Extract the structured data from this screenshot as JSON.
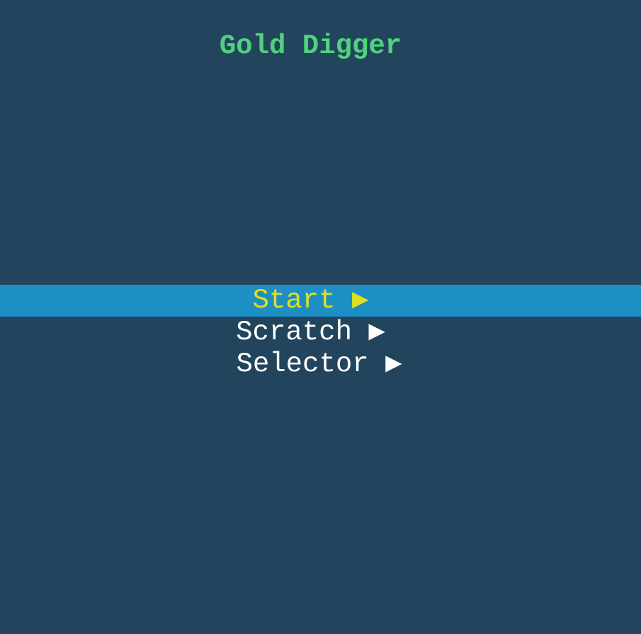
{
  "title": "Gold Digger",
  "menu": {
    "items": [
      {
        "label": "Start",
        "arrow": "▶",
        "selected": true
      },
      {
        "label": "Scratch",
        "arrow": "▶",
        "selected": false
      },
      {
        "label": "Selector",
        "arrow": "▶",
        "selected": false
      }
    ]
  },
  "colors": {
    "background": "#22445c",
    "title": "#4fd27c",
    "highlight": "#1e8fc4",
    "selected_text": "#dfe01e",
    "text": "#ffffff"
  }
}
